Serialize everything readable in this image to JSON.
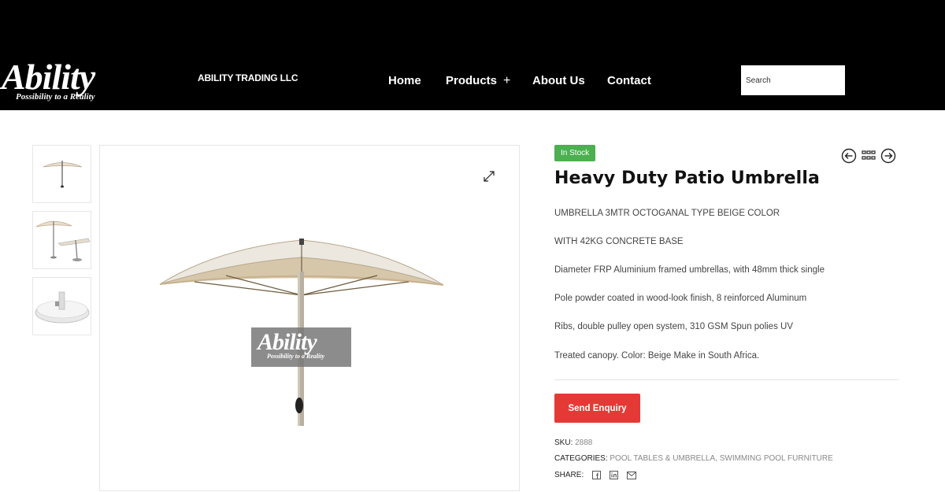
{
  "header": {
    "logo_word": "Ability",
    "logo_tagline": "Possibility to a Reality",
    "company": "ABILITY TRADING LLC",
    "nav": {
      "home": "Home",
      "products": "Products",
      "products_plus": "+",
      "about": "About Us",
      "contact": "Contact"
    },
    "search_placeholder": "Search"
  },
  "gallery": {
    "thumbnails": [
      "umbrella-thumb",
      "umbrella-side-thumb",
      "base-thumb"
    ],
    "watermark_word": "Ability",
    "watermark_tagline": "Possibility to a Reality"
  },
  "product": {
    "stock_badge": "In Stock",
    "title": "Heavy Duty Patio Umbrella",
    "description": [
      "UMBRELLA 3MTR OCTOGANAL TYPE BEIGE COLOR",
      "WITH 42KG CONCRETE BASE",
      "Diameter FRP Aluminium framed umbrellas, with 48mm thick single",
      "Pole powder coated in wood-look finish, 8 reinforced Aluminum",
      "Ribs, double pulley open system, 310 GSM Spun polies UV",
      "Treated canopy. Color: Beige Make in South Africa."
    ],
    "enquiry_button": "Send Enquiry",
    "sku_label": "SKU:",
    "sku_value": "2888",
    "categories_label": "CATEGORIES:",
    "categories": [
      "POOL TABLES & UMBRELLA",
      "SWIMMING POOL FURNITURE"
    ],
    "categories_sep": ", ",
    "share_label": "SHARE:"
  },
  "colors": {
    "header_bg": "#000000",
    "badge": "#4caf50",
    "enquiry": "#e53935",
    "canopy": "#ece4d6"
  }
}
